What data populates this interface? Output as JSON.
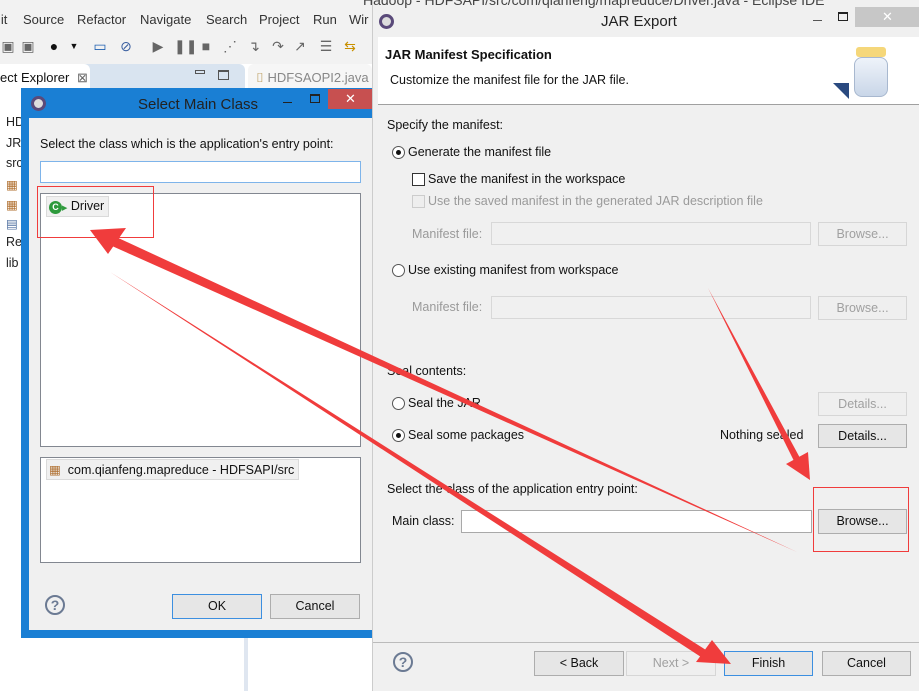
{
  "eclipse": {
    "window_title": "Hadoop - HDFSAPI/src/com/qianfeng/mapreduce/Driver.java - Eclipse IDE",
    "menu": [
      "lit",
      "Source",
      "Refactor",
      "Navigate",
      "Search",
      "Project",
      "Run",
      "Wir"
    ],
    "explorer_tab": "ect Explorer",
    "editor_tab": "HDFSAOPI2.java",
    "tree": [
      "HDFS",
      "JR",
      "src",
      "",
      "",
      "",
      "Re",
      "lib"
    ]
  },
  "select_main_class": {
    "title": "Select Main Class",
    "prompt": "Select the class which is the application's entry point:",
    "filter_value": "",
    "classes": [
      {
        "name": "Driver",
        "icon": "class-icon"
      }
    ],
    "packages": [
      {
        "name": "com.qianfeng.mapreduce - HDFSAPI/src",
        "icon": "package-icon"
      }
    ],
    "ok": "OK",
    "cancel": "Cancel"
  },
  "jar_export": {
    "title": "JAR Export",
    "header_title": "JAR Manifest Specification",
    "header_desc": "Customize the manifest file for the JAR file.",
    "specify_label": "Specify the manifest:",
    "generate_label": "Generate the manifest file",
    "generate_selected": true,
    "save_label": "Save the manifest in the workspace",
    "save_checked": false,
    "use_saved_label": "Use the saved manifest in the generated JAR description file",
    "manifest_file_label": "Manifest file:",
    "browse": "Browse...",
    "use_existing_label": "Use existing manifest from workspace",
    "seal_label": "Seal contents:",
    "seal_jar": "Seal the JAR",
    "seal_some": "Seal some packages",
    "nothing_sealed": "Nothing sealed",
    "details": "Details...",
    "entry_label": "Select the class of the application entry point:",
    "main_class_label": "Main class:",
    "main_class_value": "",
    "back": "< Back",
    "next": "Next >",
    "finish": "Finish",
    "cancel": "Cancel"
  },
  "annotation_color": "#f03c3c",
  "accent": "#1a7fd4"
}
